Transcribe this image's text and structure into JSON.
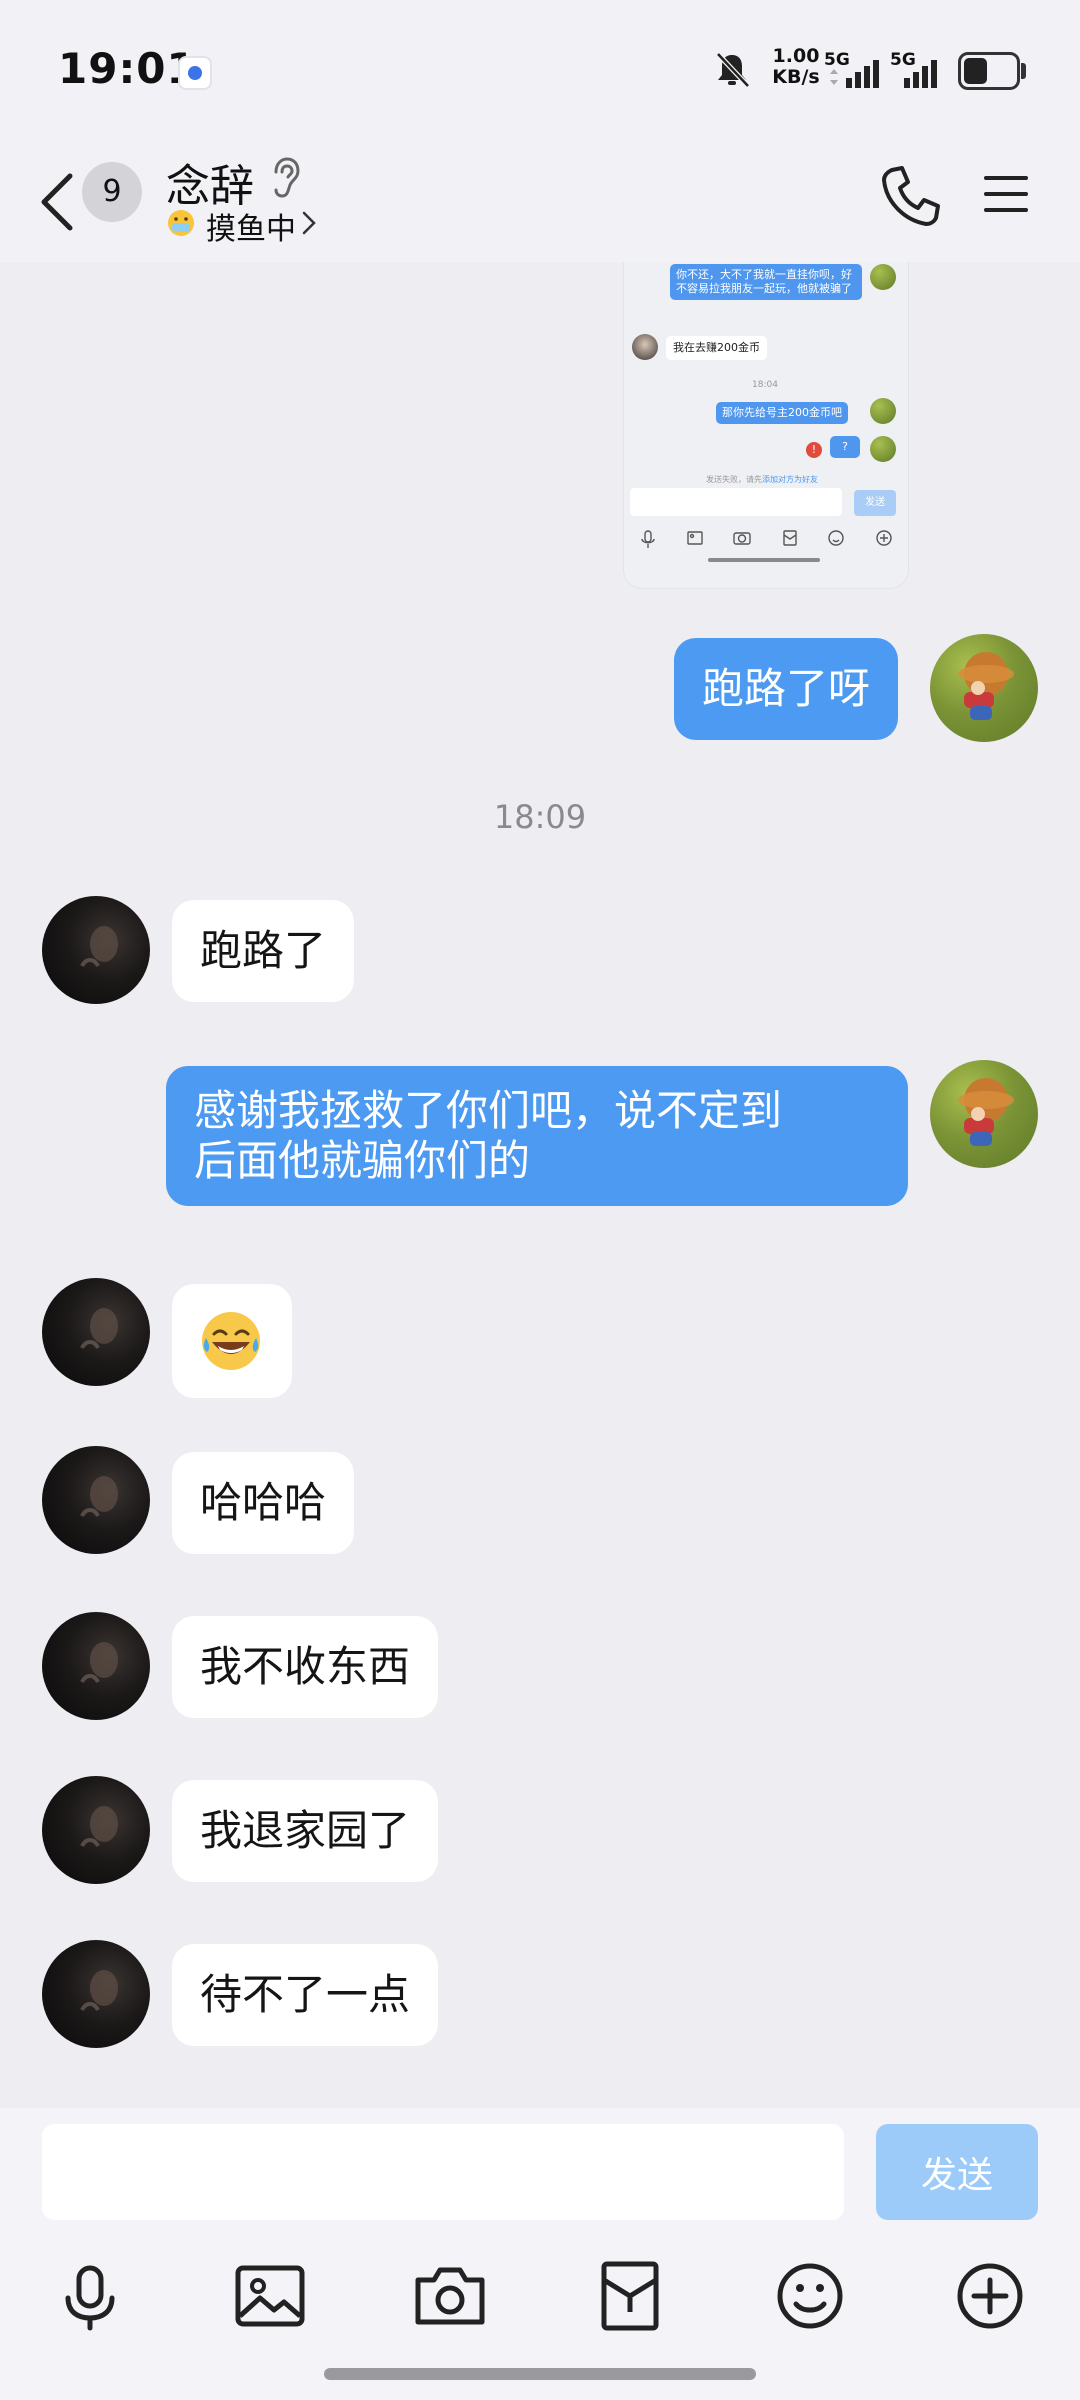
{
  "status_bar": {
    "time": "19:01",
    "net_speed_value": "1.00",
    "net_speed_unit": "KB/s",
    "signal1_label": "5G",
    "signal2_label": "5G",
    "battery_level": 0.45
  },
  "header": {
    "unread_count": "9",
    "contact_name": "念辞",
    "contact_status": "摸鱼中"
  },
  "screenshot_message": {
    "msg1": "你不还，大不了我就一直挂你呗，好不容易拉我朋友一起玩，他就被骗了",
    "msg2": "我在去赚200金币",
    "time": "18:04",
    "msg3": "那你先给号主200金币吧",
    "msg4": "?",
    "tip_prefix": "发送失败，请先",
    "tip_link": "添加对方为好友",
    "send_label": "发送"
  },
  "messages": {
    "m1": "跑路了呀",
    "time1": "18:09",
    "m2": "跑路了",
    "m3_line1": "感谢我拯救了你们吧，说不定到",
    "m3_line2": "后面他就骗你们的",
    "m5": "哈哈哈",
    "m6": "我不收东西",
    "m7": "我退家园了",
    "m8": "待不了一点"
  },
  "input": {
    "placeholder": "",
    "send_label": "发送"
  },
  "colors": {
    "accent": "#4c9af2",
    "send_disabled": "#9ccbf9",
    "background": "#ededf2"
  },
  "icons": [
    "back-icon",
    "ear-icon",
    "phone-icon",
    "menu-icon",
    "mic-icon",
    "image-icon",
    "camera-icon",
    "red-packet-icon",
    "emoji-icon",
    "plus-icon"
  ]
}
